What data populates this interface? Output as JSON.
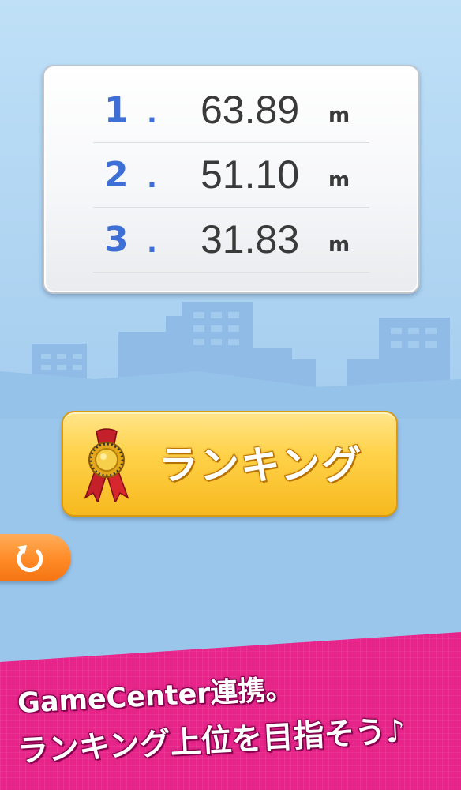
{
  "scores": {
    "unit": "m",
    "rows": [
      {
        "rank": "1",
        "dot": ".",
        "distance": "63.89"
      },
      {
        "rank": "2",
        "dot": ".",
        "distance": "51.10"
      },
      {
        "rank": "3",
        "dot": ".",
        "distance": "31.83"
      }
    ]
  },
  "ranking_button": {
    "label": "ランキング",
    "icon": "medal-ribbon-icon"
  },
  "retry_button": {
    "icon": "retry-arrow-icon"
  },
  "promo": {
    "line1": "GameCenter連携。",
    "line2": "ランキング上位を目指そう♪"
  },
  "colors": {
    "sky": "#a9d0f0",
    "buildings": "#8fbbe6",
    "rank_blue": "#3e6fd6",
    "button_yellow": "#ffd24a",
    "retry_orange": "#ff8a26",
    "promo_pink": "#e8248a"
  }
}
